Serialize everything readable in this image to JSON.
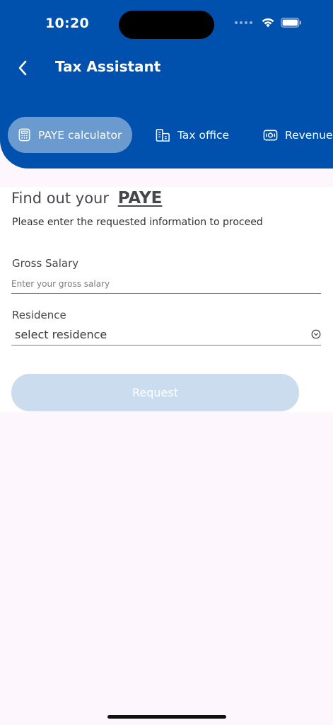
{
  "status_bar": {
    "time": "10:20"
  },
  "header": {
    "title": "Tax Assistant",
    "background_color": "#0051ad"
  },
  "tabs": [
    {
      "label": "PAYE calculator",
      "icon": "calculator-icon",
      "active": true
    },
    {
      "label": "Tax office",
      "icon": "building-icon",
      "active": false
    },
    {
      "label": "Revenue",
      "icon": "money-icon",
      "active": false
    }
  ],
  "form": {
    "heading_prefix": "Find out your",
    "heading_emphasis": "PAYE",
    "subtitle": "Please enter the requested information to proceed",
    "gross_salary": {
      "label": "Gross Salary",
      "value": "",
      "placeholder": "Enter your gross salary"
    },
    "residence": {
      "label": "Residence",
      "selected": "select residence"
    },
    "submit_label": "Request"
  }
}
